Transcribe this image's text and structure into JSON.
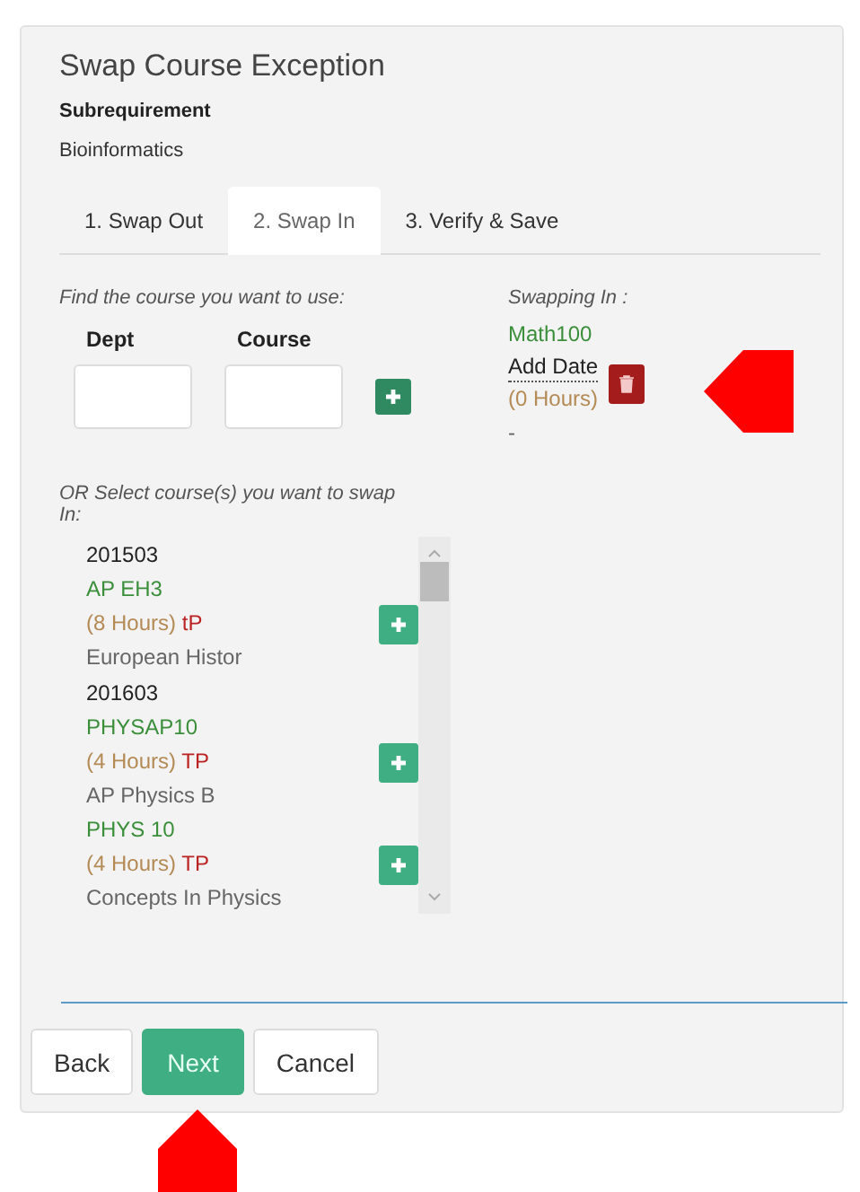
{
  "dialog": {
    "title": "Swap Course Exception",
    "subrequirement_label": "Subrequirement",
    "subrequirement_value": "Bioinformatics"
  },
  "tabs": [
    {
      "label": "1. Swap Out",
      "selected": false
    },
    {
      "label": "2. Swap In",
      "selected": true
    },
    {
      "label": "3. Verify & Save",
      "selected": false
    }
  ],
  "find": {
    "prompt": "Find the course you want to use:",
    "fields": [
      {
        "label": "Dept"
      },
      {
        "label": "Course"
      }
    ]
  },
  "swapping_in": {
    "heading": "Swapping In :",
    "course": "Math100",
    "date_link": "Add Date",
    "hours": "(0 Hours)",
    "note": "-"
  },
  "select_prompt": "OR Select course(s) you want to swap In:",
  "course_list": [
    {
      "kind": "term",
      "label": "201503"
    },
    {
      "kind": "course",
      "code": "AP EH3",
      "hours": "(8 Hours)",
      "status": "tP",
      "title": "European Histor"
    },
    {
      "kind": "term",
      "label": "201603"
    },
    {
      "kind": "course",
      "code": "PHYSAP10",
      "hours": "(4 Hours)",
      "status": "TP",
      "title": "AP Physics B"
    },
    {
      "kind": "course",
      "code": "PHYS 10",
      "hours": "(4 Hours)",
      "status": "TP",
      "title": "Concepts In Physics"
    }
  ],
  "buttons": [
    {
      "label": "Back",
      "kind": "default"
    },
    {
      "label": "Next",
      "kind": "primary"
    },
    {
      "label": "Cancel",
      "kind": "default"
    }
  ]
}
